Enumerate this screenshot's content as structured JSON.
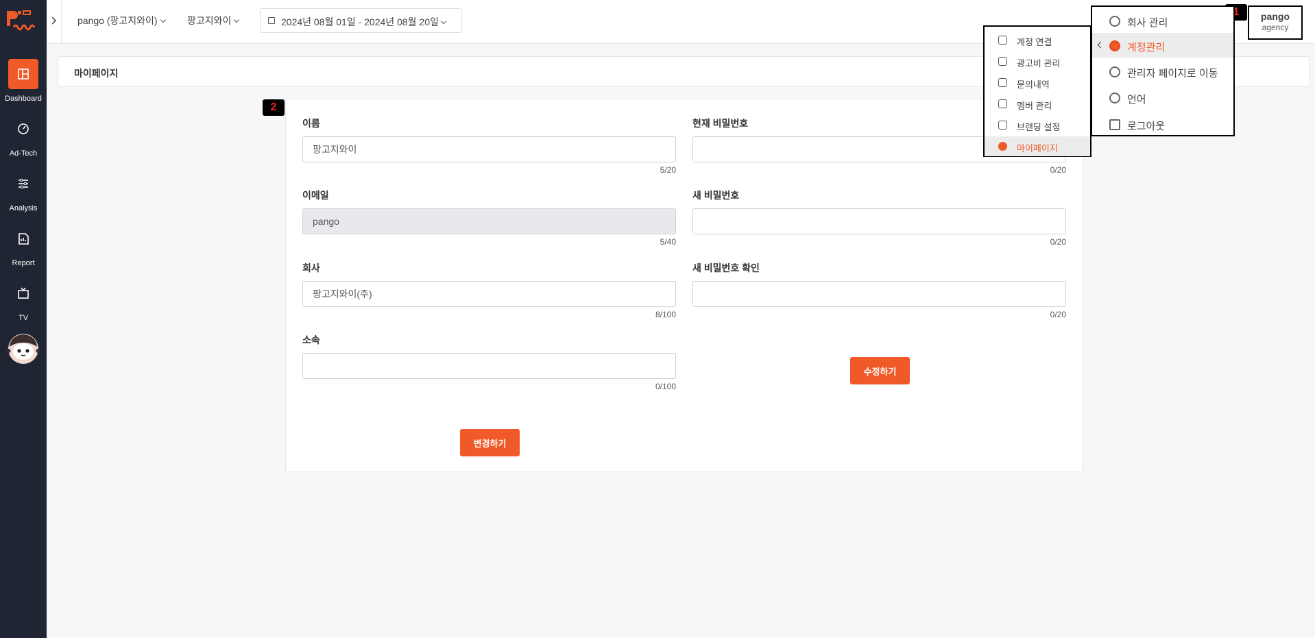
{
  "sidebar": {
    "logo_text": "Pango",
    "items": [
      {
        "label": "Dashboard",
        "icon": "dashboard-icon",
        "active": true
      },
      {
        "label": "Ad-Tech",
        "icon": "speedometer-icon",
        "active": false
      },
      {
        "label": "Analysis",
        "icon": "sliders-icon",
        "active": false
      },
      {
        "label": "Report",
        "icon": "report-icon",
        "active": false
      },
      {
        "label": "TV",
        "icon": "tv-icon",
        "active": false
      }
    ]
  },
  "topbar": {
    "account_select": "pango (팡고지와이)",
    "company_select": "팡고지와이",
    "date_range": "2024년 08월 01일 - 2024년 08월 20일",
    "user_name": "pango",
    "user_role": "agency"
  },
  "page": {
    "title": "마이페이지"
  },
  "markers": {
    "m1": "1",
    "m2": "2"
  },
  "profile_form": {
    "name_label": "이름",
    "name_value": "팡고지와이",
    "name_counter": "5/20",
    "email_label": "이메일",
    "email_value": "pango",
    "email_counter": "5/40",
    "company_label": "회사",
    "company_value": "팡고지와이(주)",
    "company_counter": "8/100",
    "affiliation_label": "소속",
    "affiliation_value": "",
    "affiliation_counter": "0/100",
    "submit_label": "변경하기"
  },
  "password_form": {
    "current_label": "현재 비밀번호",
    "current_counter": "0/20",
    "new_label": "새 비밀번호",
    "new_counter": "0/20",
    "confirm_label": "새 비밀번호 확인",
    "confirm_counter": "0/20",
    "submit_label": "수정하기"
  },
  "user_menu": {
    "items": [
      {
        "label": "회사 관리",
        "icon": "company-user-icon"
      },
      {
        "label": "계정관리",
        "icon": "account-user-icon",
        "active": true
      },
      {
        "label": "관리자 페이지로 이동",
        "icon": "admin-user-icon"
      },
      {
        "label": "언어",
        "icon": "globe-icon"
      },
      {
        "label": "로그아웃",
        "icon": "logout-icon"
      }
    ]
  },
  "account_submenu": {
    "items": [
      {
        "label": "계정 연결",
        "icon": "network-icon"
      },
      {
        "label": "광고비 관리",
        "icon": "money-icon"
      },
      {
        "label": "문의내역",
        "icon": "headset-icon"
      },
      {
        "label": "멤버 관리",
        "icon": "members-icon"
      },
      {
        "label": "브랜딩 설정",
        "icon": "cursor-click-icon"
      },
      {
        "label": "마이페이지",
        "icon": "user-circle-icon",
        "active": true
      }
    ]
  },
  "colors": {
    "accent": "#f05a28",
    "sidebar_bg": "#1f2533"
  }
}
